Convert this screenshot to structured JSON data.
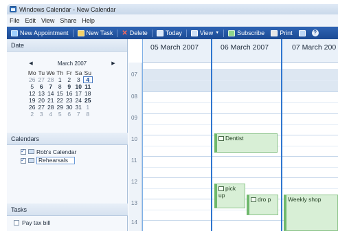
{
  "window": {
    "title": "Windows Calendar - New Calendar"
  },
  "menu": [
    "File",
    "Edit",
    "View",
    "Share",
    "Help"
  ],
  "toolbar": {
    "new_appointment": "New Appointment",
    "new_task": "New Task",
    "delete": "Delete",
    "today": "Today",
    "view": "View",
    "subscribe": "Subscribe",
    "print": "Print"
  },
  "sidebar": {
    "date_header": "Date",
    "month_label": "March 2007",
    "weekdays": [
      "Mo",
      "Tu",
      "We",
      "Th",
      "Fr",
      "Sa",
      "Su"
    ],
    "weeks": [
      [
        "26",
        "27",
        "28",
        "1",
        "2",
        "3",
        "4"
      ],
      [
        "5",
        "6",
        "7",
        "8",
        "9",
        "10",
        "11"
      ],
      [
        "12",
        "13",
        "14",
        "15",
        "16",
        "17",
        "18"
      ],
      [
        "19",
        "20",
        "21",
        "22",
        "23",
        "24",
        "25"
      ],
      [
        "26",
        "27",
        "28",
        "29",
        "30",
        "31",
        "1"
      ],
      [
        "2",
        "3",
        "4",
        "5",
        "6",
        "7",
        "8"
      ]
    ],
    "calendars_header": "Calendars",
    "calendars": [
      {
        "label": "Rob's Calendar",
        "checked": true
      },
      {
        "label": "Rehearsals",
        "checked": true,
        "editing": true
      }
    ],
    "tasks_header": "Tasks",
    "tasks": [
      {
        "label": "Pay tax bill",
        "checked": false
      }
    ]
  },
  "calendar": {
    "days": [
      "05 March 2007",
      "06 March 2007",
      "07 March 200"
    ],
    "hours": [
      "07",
      "08",
      "09",
      "10",
      "11",
      "12",
      "13",
      "14"
    ],
    "appointments": [
      {
        "title": "Dentist",
        "day": "06 March 2007",
        "start": "10:00"
      },
      {
        "title": "pick up",
        "day": "06 March 2007",
        "start": "13:00"
      },
      {
        "title": "dro p",
        "day": "06 March 2007",
        "start": "13:30"
      },
      {
        "title": "Weekly shop",
        "day": "07 March 200",
        "start": "13:00"
      }
    ]
  },
  "colors": {
    "accent": "#2f76cf",
    "appointment": "#d8efd6",
    "toolbar": "#1b4a93"
  }
}
